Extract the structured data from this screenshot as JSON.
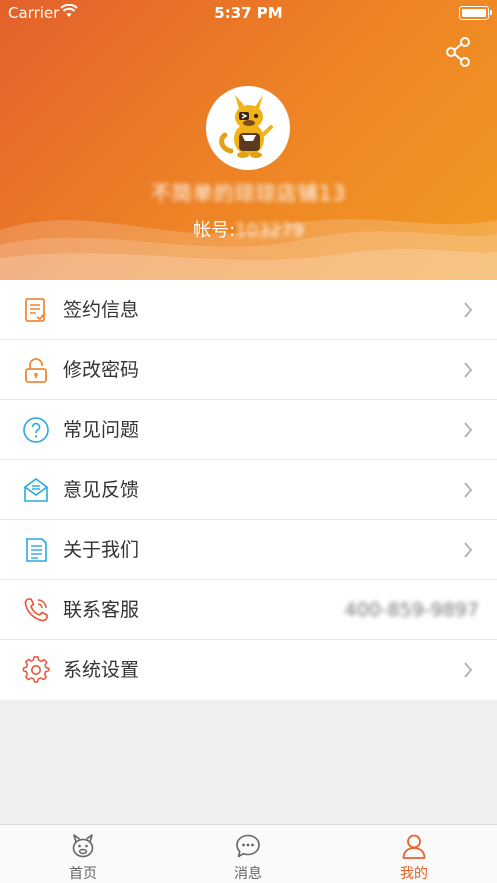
{
  "status_bar": {
    "carrier": "Carrier",
    "time": "5:37 PM"
  },
  "profile": {
    "nickname": "不简单的琼琼店铺13",
    "account_label": "帐号:",
    "account_value": "103279"
  },
  "menu": {
    "items": [
      {
        "label": "签约信息",
        "icon": "contract-icon"
      },
      {
        "label": "修改密码",
        "icon": "lock-icon"
      },
      {
        "label": "常见问题",
        "icon": "question-icon"
      },
      {
        "label": "意见反馈",
        "icon": "mail-icon"
      },
      {
        "label": "关于我们",
        "icon": "document-icon"
      },
      {
        "label": "联系客服",
        "icon": "phone-icon",
        "value": "400-859-9897"
      },
      {
        "label": "系统设置",
        "icon": "gear-icon"
      }
    ]
  },
  "tabbar": {
    "tabs": [
      {
        "label": "首页",
        "icon": "kangaroo-icon"
      },
      {
        "label": "消息",
        "icon": "chat-icon"
      },
      {
        "label": "我的",
        "icon": "user-icon",
        "active": true
      }
    ]
  },
  "colors": {
    "header_start": "#e2612a",
    "header_end": "#f29a22",
    "accent": "#e8622a",
    "icon_orange": "#f08a3c",
    "icon_blue": "#29a8e0",
    "icon_red": "#e8553a"
  }
}
